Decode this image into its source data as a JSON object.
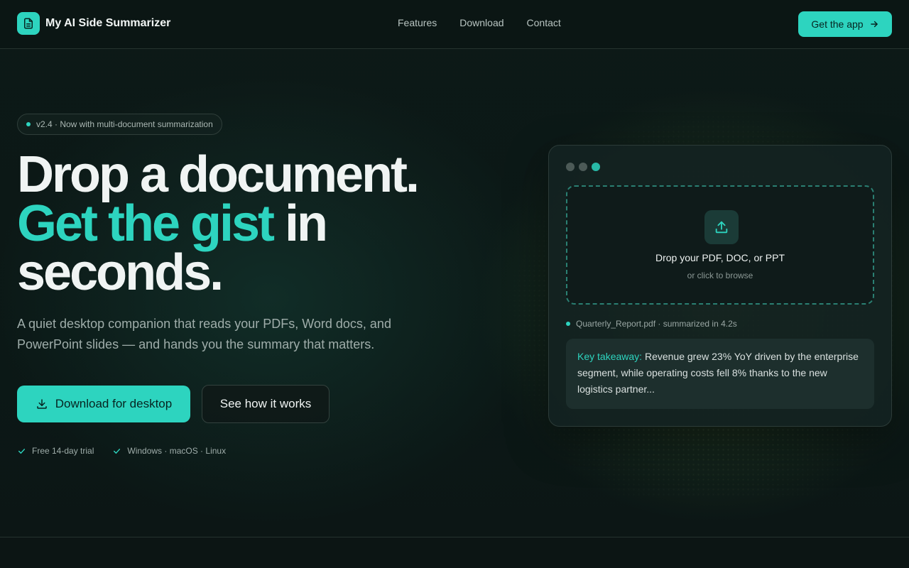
{
  "brand": {
    "name": "My AI Side Summarizer",
    "logo_icon": "document-icon"
  },
  "nav": {
    "links": [
      "Features",
      "Download",
      "Contact"
    ],
    "cta_label": "Get the app"
  },
  "hero": {
    "badge": "v2.4 · Now with multi-document summarization",
    "headline_line1": "Drop a document.",
    "headline_accent": "Get the gist",
    "headline_rest": " in",
    "headline_line3": "seconds.",
    "lede": "A quiet desktop companion that reads your PDFs, Word docs, and PowerPoint slides — and hands you the summary that matters.",
    "primary_cta": "Download for desktop",
    "secondary_cta": "See how it works",
    "checks": [
      "Free 14-day trial",
      "Windows · macOS · Linux"
    ]
  },
  "preview": {
    "drop_title": "Drop your PDF, DOC, or PPT",
    "drop_sub": "or click to browse",
    "file_status": "Quarterly_Report.pdf · summarized in 4.2s",
    "takeaway_label": "Key takeaway:",
    "takeaway_text": " Revenue grew 23% YoY driven by the enterprise segment, while operating costs fell 8% thanks to the new logistics partner..."
  },
  "colors": {
    "accent": "#2dd4bf",
    "background": "#0b1514",
    "card": "#132221"
  }
}
